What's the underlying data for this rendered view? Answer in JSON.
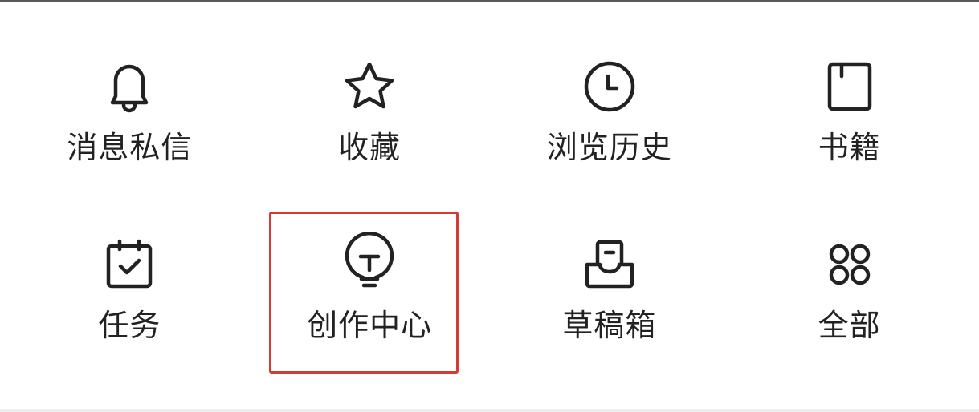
{
  "menu": {
    "items": [
      {
        "label": "消息私信",
        "icon": "bell-icon"
      },
      {
        "label": "收藏",
        "icon": "star-icon"
      },
      {
        "label": "浏览历史",
        "icon": "clock-icon"
      },
      {
        "label": "书籍",
        "icon": "book-icon"
      },
      {
        "label": "任务",
        "icon": "calendar-check-icon"
      },
      {
        "label": "创作中心",
        "icon": "lightbulb-icon"
      },
      {
        "label": "草稿箱",
        "icon": "inbox-icon"
      },
      {
        "label": "全部",
        "icon": "grid-circles-icon"
      }
    ],
    "selected_index": 5
  },
  "colors": {
    "text": "#222222",
    "icon_stroke": "#222222",
    "highlight": "#d63a32",
    "background": "#ffffff"
  }
}
